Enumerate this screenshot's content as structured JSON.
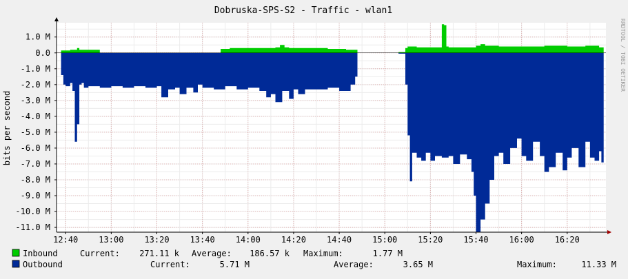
{
  "chart_data": {
    "type": "area",
    "title": "Dobruska-SPS-S2 - Traffic - wlan1",
    "ylabel": "bits per second",
    "watermark": "RRDTOOL / TOBI OETIKER",
    "y_ticks": [
      "1.0 M",
      "0.0",
      "-1.0 M",
      "-2.0 M",
      "-3.0 M",
      "-4.0 M",
      "-5.0 M",
      "-6.0 M",
      "-7.0 M",
      "-8.0 M",
      "-9.0 M",
      "-10.0 M",
      "-11.0 M"
    ],
    "x_ticks": [
      "12:40",
      "13:00",
      "13:20",
      "13:40",
      "14:00",
      "14:20",
      "14:40",
      "15:00",
      "15:20",
      "15:40",
      "16:00",
      "16:20"
    ],
    "ylim": [
      -11.3,
      1.9
    ],
    "time_start": "12:36",
    "time_end": "16:37",
    "grid": true,
    "colors": {
      "inbound": "#00cc00",
      "outbound": "#002a97",
      "background": "#f0f0f0",
      "canvas": "#ffffff",
      "grid": "#e0b0b0",
      "axis": "#000000"
    },
    "series": [
      {
        "name": "Inbound",
        "color": "#00cc00",
        "x": [
          "12:38",
          "12:42",
          "12:45",
          "12:46",
          "12:48",
          "12:55",
          "13:10",
          "13:30",
          "13:48",
          "13:52",
          "13:58",
          "14:05",
          "14:12",
          "14:14",
          "14:16",
          "14:18",
          "14:25",
          "14:35",
          "14:43",
          "14:48",
          "15:06",
          "15:09",
          "15:10",
          "15:14",
          "15:20",
          "15:24",
          "15:25",
          "15:26",
          "15:27",
          "15:28",
          "15:30",
          "15:40",
          "15:42",
          "15:44",
          "15:50",
          "16:00",
          "16:10",
          "16:20",
          "16:28",
          "16:34",
          "16:36"
        ],
        "values": [
          0.15,
          0.2,
          0.3,
          0.2,
          0.2,
          0.2,
          0.2,
          0.2,
          0.25,
          0.3,
          0.3,
          0.3,
          0.35,
          0.5,
          0.35,
          0.3,
          0.3,
          0.25,
          0.2,
          0.15,
          0.05,
          0.3,
          0.4,
          0.35,
          0.35,
          0.35,
          1.8,
          1.75,
          0.4,
          0.35,
          0.35,
          0.45,
          0.55,
          0.45,
          0.4,
          0.4,
          0.45,
          0.4,
          0.45,
          0.35,
          0.3
        ]
      },
      {
        "name": "Outbound",
        "color": "#002a97",
        "x": [
          "12:38",
          "12:39",
          "12:40",
          "12:42",
          "12:43",
          "12:44",
          "12:45",
          "12:46",
          "12:47",
          "12:48",
          "12:50",
          "12:55",
          "13:00",
          "13:05",
          "13:10",
          "13:15",
          "13:20",
          "13:22",
          "13:25",
          "13:28",
          "13:30",
          "13:33",
          "13:36",
          "13:38",
          "13:40",
          "13:45",
          "13:50",
          "13:55",
          "14:00",
          "14:05",
          "14:08",
          "14:10",
          "14:12",
          "14:15",
          "14:18",
          "14:20",
          "14:22",
          "14:25",
          "14:30",
          "14:35",
          "14:40",
          "14:45",
          "14:47",
          "14:48",
          "15:06",
          "15:09",
          "15:10",
          "15:11",
          "15:12",
          "15:14",
          "15:16",
          "15:18",
          "15:20",
          "15:22",
          "15:25",
          "15:28",
          "15:30",
          "15:33",
          "15:36",
          "15:38",
          "15:39",
          "15:40",
          "15:42",
          "15:44",
          "15:46",
          "15:48",
          "15:50",
          "15:52",
          "15:55",
          "15:58",
          "16:00",
          "16:02",
          "16:05",
          "16:08",
          "16:10",
          "16:12",
          "16:15",
          "16:18",
          "16:20",
          "16:22",
          "16:25",
          "16:28",
          "16:30",
          "16:32",
          "16:34",
          "16:35",
          "16:36"
        ],
        "values": [
          -1.4,
          -2.0,
          -2.1,
          -1.9,
          -2.4,
          -5.6,
          -4.5,
          -2.0,
          -1.9,
          -2.2,
          -2.1,
          -2.2,
          -2.1,
          -2.2,
          -2.1,
          -2.2,
          -2.1,
          -2.8,
          -2.3,
          -2.2,
          -2.6,
          -2.2,
          -2.5,
          -2.0,
          -2.2,
          -2.3,
          -2.1,
          -2.3,
          -2.2,
          -2.4,
          -2.8,
          -2.6,
          -3.1,
          -2.4,
          -2.9,
          -2.3,
          -2.6,
          -2.3,
          -2.3,
          -2.2,
          -2.4,
          -2.0,
          -1.5,
          -0.5,
          -0.05,
          -2.0,
          -5.2,
          -8.1,
          -6.3,
          -6.6,
          -6.8,
          -6.3,
          -6.8,
          -6.5,
          -6.6,
          -6.5,
          -7.0,
          -6.4,
          -6.7,
          -7.5,
          -9.0,
          -11.3,
          -10.5,
          -9.5,
          -8.0,
          -6.5,
          -6.3,
          -7.0,
          -6.0,
          -5.4,
          -6.5,
          -6.8,
          -5.6,
          -6.5,
          -7.5,
          -7.2,
          -6.3,
          -7.4,
          -6.6,
          -6.0,
          -7.2,
          -5.6,
          -6.6,
          -6.8,
          -6.2,
          -6.9,
          -5.7
        ]
      }
    ],
    "legend": [
      {
        "name": "Inbound",
        "color": "#00cc00",
        "current_label": "Current:",
        "current": "271.11 k",
        "average_label": "Average:",
        "average": "186.57 k",
        "maximum_label": "Maximum:",
        "maximum": "1.77 M"
      },
      {
        "name": "Outbound",
        "color": "#002a97",
        "current_label": "Current:",
        "current": "5.71 M",
        "average_label": "Average:",
        "average": "3.65 M",
        "maximum_label": "Maximum:",
        "maximum": "11.33 M"
      }
    ]
  }
}
